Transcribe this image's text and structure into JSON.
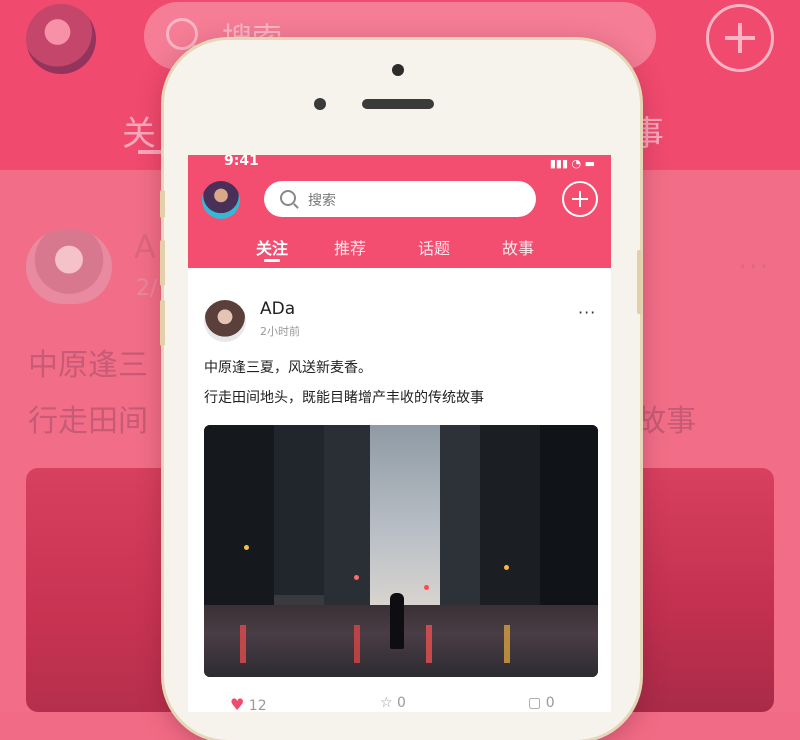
{
  "app": {
    "status_time": "9:41",
    "status_icons": "▮▮▮ ◔ ▬",
    "search_placeholder": "搜索",
    "tabs": [
      {
        "label": "关注",
        "active": true
      },
      {
        "label": "推荐",
        "active": false
      },
      {
        "label": "话题",
        "active": false
      },
      {
        "label": "故事",
        "active": false
      }
    ]
  },
  "post": {
    "author": "ADa",
    "time": "2小时前",
    "more": "···",
    "lines": [
      "中原逢三夏，风送新麦香。",
      "行走田间地头，既能目睹增产丰收的传统故事"
    ],
    "actions": {
      "like_count": "12",
      "star_count": "0",
      "comment_count": "0"
    }
  },
  "background": {
    "search_text": "搜索",
    "tab_partial_left": "关",
    "tab_partial_right": "事",
    "post_name_partial": "A",
    "post_time_partial": "2/",
    "line1_partial": "中原逢三",
    "line2_partial": "行走田间",
    "line2_right_partial": "故事",
    "more": "···"
  },
  "colors": {
    "accent": "#f34d70",
    "background": "#f26b86"
  }
}
